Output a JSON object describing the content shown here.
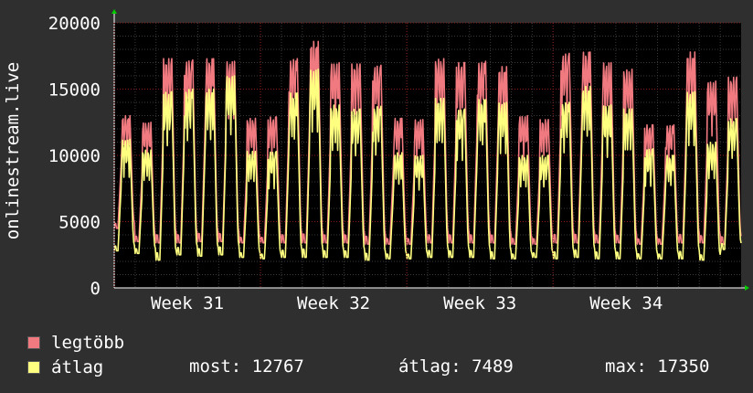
{
  "chart_data": {
    "type": "area",
    "ylabel": "onlinestream.live",
    "ylim": [
      0,
      20000
    ],
    "yticks": [
      0,
      5000,
      10000,
      15000,
      20000
    ],
    "xticks": [
      "Week 31",
      "Week 32",
      "Week 33",
      "Week 34"
    ],
    "days": 30,
    "series": [
      {
        "name": "legtöbb",
        "color": "#f07a80",
        "daily_peak": [
          13000,
          12500,
          17300,
          17200,
          17300,
          17100,
          12800,
          12900,
          17300,
          18600,
          17000,
          16900,
          16800,
          12800,
          12700,
          17300,
          17000,
          17100,
          16700,
          13000,
          12700,
          17700,
          17800,
          17000,
          16500,
          12300,
          12300,
          17800,
          15600,
          15900
        ],
        "daily_low": [
          4500,
          3500,
          3400,
          3400,
          3500,
          3500,
          3400,
          3400,
          3400,
          3400,
          3400,
          3400,
          3300,
          3300,
          3300,
          3400,
          3400,
          3400,
          3400,
          3300,
          3300,
          3400,
          3400,
          3400,
          3400,
          3300,
          3300,
          3400,
          3400,
          3300
        ]
      },
      {
        "name": "átlag",
        "color": "#ffff80",
        "daily_peak": [
          11200,
          10400,
          14800,
          15000,
          15000,
          16000,
          10300,
          10300,
          14700,
          16500,
          13800,
          13500,
          13700,
          10200,
          10000,
          14300,
          13500,
          14200,
          14000,
          10000,
          10000,
          14000,
          15200,
          13800,
          13500,
          10500,
          10000,
          14800,
          11000,
          12767
        ],
        "daily_low": [
          2800,
          2600,
          2100,
          2500,
          2400,
          2500,
          2300,
          2200,
          2300,
          2300,
          2300,
          2300,
          2100,
          2200,
          2200,
          2300,
          2300,
          2300,
          2200,
          2200,
          2300,
          2200,
          2300,
          2200,
          2200,
          2200,
          2200,
          2200,
          2100,
          2900
        ]
      }
    ],
    "legend": [
      {
        "label": "legtöbb",
        "color": "#f07a80"
      },
      {
        "label": "átlag",
        "color": "#ffff80"
      }
    ],
    "stats": {
      "most_label": "most:",
      "most_value": "12767",
      "avg_label": "átlag:",
      "avg_value": "7489",
      "max_label": "max:",
      "max_value": "17350"
    },
    "grid": true,
    "colors": {
      "background": "#2f2f2f",
      "plot_bg": "#000000",
      "grid_minor": "#3a3a3a",
      "grid_major": "#8b1a1a",
      "arrow": "#00cc00"
    }
  }
}
